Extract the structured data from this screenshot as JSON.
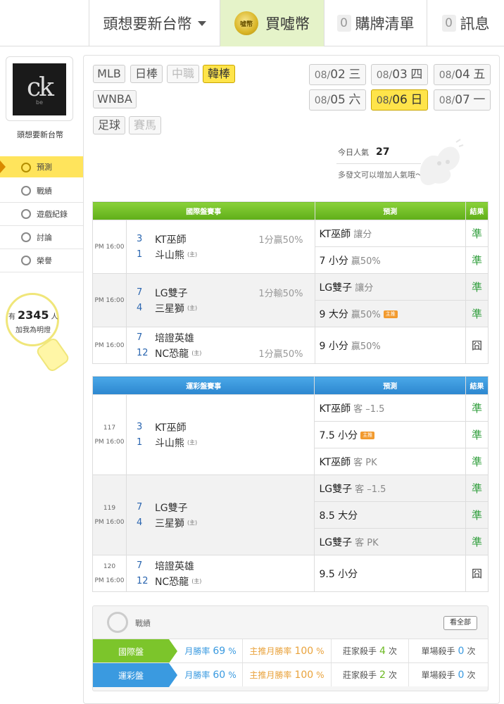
{
  "topbar": {
    "user": "頭想要新台幣",
    "buy_label": "買噓幣",
    "coin_text": "噓幣",
    "cart_count": "0",
    "cart_label": "購牌清單",
    "msg_count": "0",
    "msg_label": "訊息"
  },
  "sidebar": {
    "avatar_logo": "ck",
    "avatar_sub": "be",
    "username": "頭想要新台幣",
    "nav": [
      {
        "label": "預測",
        "icon": "target-icon"
      },
      {
        "label": "戰績",
        "icon": "chat-icon"
      },
      {
        "label": "遊戲紀錄",
        "icon": "circle-icon"
      },
      {
        "label": "討論",
        "icon": "compass-icon"
      },
      {
        "label": "榮譽",
        "icon": "medal-icon"
      }
    ],
    "fans_prefix": "有",
    "fans_count": "2345",
    "fans_suffix": "人",
    "fans_sub": "加我為明燈"
  },
  "leagues": [
    "MLB",
    "日棒",
    "中職",
    "韓棒",
    "WNBA",
    "足球",
    "賽馬"
  ],
  "dates": [
    {
      "md": "08/",
      "d": "02",
      "w": "三"
    },
    {
      "md": "08/",
      "d": "03",
      "w": "四"
    },
    {
      "md": "08/",
      "d": "04",
      "w": "五"
    },
    {
      "md": "08/",
      "d": "05",
      "w": "六"
    },
    {
      "md": "08/",
      "d": "06",
      "w": "日"
    },
    {
      "md": "08/",
      "d": "07",
      "w": "一"
    }
  ],
  "popularity": {
    "label": "今日人氣",
    "value": "27",
    "sub": "多發文可以增加人氣哦～"
  },
  "intl": {
    "headers": [
      "國際盤賽事",
      "預測",
      "結果"
    ],
    "games": [
      {
        "time": "PM 16:00",
        "s1": "3",
        "t1": "KT巫師",
        "s2": "1",
        "t2": "斗山熊",
        "home": "(主)",
        "handi": "1分贏50%",
        "p1": "KT巫師",
        "p1s": "讓分",
        "r1": "準",
        "p2": "7 小分",
        "p2s": "贏50%",
        "r2": "準"
      },
      {
        "time": "PM 16:00",
        "s1": "7",
        "t1": "LG雙子",
        "s2": "4",
        "t2": "三星獅",
        "home": "(主)",
        "handi": "1分輸50%",
        "p1": "LG雙子",
        "p1s": "讓分",
        "r1": "準",
        "p2": "9 大分",
        "p2s": "贏50%",
        "badge": "主推",
        "r2": "準"
      },
      {
        "time": "PM 16:00",
        "s1": "7",
        "t1": "培證英雄",
        "s2": "12",
        "t2": "NC恐龍",
        "home": "(主)",
        "handi": "1分贏50%",
        "p1": "9 小分",
        "p1s": "贏50%",
        "r1": "囧"
      }
    ]
  },
  "lottery": {
    "headers": [
      "運彩盤賽事",
      "預測",
      "結果"
    ],
    "games": [
      {
        "no": "117",
        "time": "PM 16:00",
        "s1": "3",
        "t1": "KT巫師",
        "s2": "1",
        "t2": "斗山熊",
        "home": "(主)",
        "preds": [
          {
            "t": "KT巫師",
            "s": "客 –1.5",
            "r": "準"
          },
          {
            "t": "7.5 小分",
            "s": "",
            "badge": "主推",
            "r": "準"
          },
          {
            "t": "KT巫師",
            "s": "客 PK",
            "r": "準"
          }
        ]
      },
      {
        "no": "119",
        "time": "PM 16:00",
        "s1": "7",
        "t1": "LG雙子",
        "s2": "4",
        "t2": "三星獅",
        "home": "(主)",
        "preds": [
          {
            "t": "LG雙子",
            "s": "客 –1.5",
            "r": "準"
          },
          {
            "t": "8.5 大分",
            "s": "",
            "r": "準"
          },
          {
            "t": "LG雙子",
            "s": "客 PK",
            "r": "準"
          }
        ]
      },
      {
        "no": "120",
        "time": "PM 16:00",
        "s1": "7",
        "t1": "培證英雄",
        "s2": "12",
        "t2": "NC恐龍",
        "home": "(主)",
        "preds": [
          {
            "t": "9.5 小分",
            "s": "",
            "r": "囧"
          }
        ]
      }
    ]
  },
  "record": {
    "title": "戰績",
    "view_all": "看全部",
    "rows": [
      {
        "tag": "國際盤",
        "a_label": "月勝率",
        "a_val": "69",
        "a_unit": "%",
        "b_label": "主推月勝率",
        "b_val": "100",
        "b_unit": "%",
        "c_label": "莊家殺手",
        "c_val": "4",
        "c_unit": "次",
        "d_label": "單場殺手",
        "d_val": "0",
        "d_unit": "次"
      },
      {
        "tag": "運彩盤",
        "a_label": "月勝率",
        "a_val": "60",
        "a_unit": "%",
        "b_label": "主推月勝率",
        "b_val": "100",
        "b_unit": "%",
        "c_label": "莊家殺手",
        "c_val": "2",
        "c_unit": "次",
        "d_label": "單場殺手",
        "d_val": "0",
        "d_unit": "次"
      }
    ]
  },
  "colors": {
    "accent_yellow": "#ffe44a",
    "green": "#6cb922",
    "blue": "#3a9ae0",
    "correct": "#2e9d3a",
    "score_blue": "#2b66b0"
  }
}
